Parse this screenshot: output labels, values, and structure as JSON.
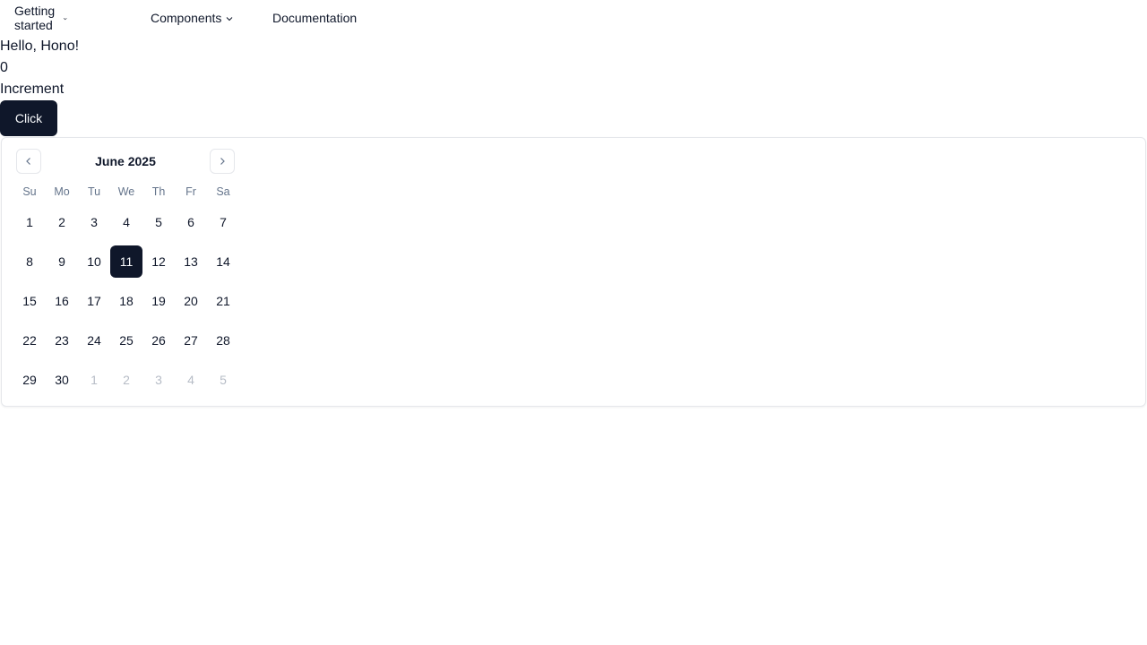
{
  "nav": {
    "getting_started": "Getting started",
    "components": "Components",
    "documentation": "Documentation"
  },
  "content": {
    "greeting": "Hello, Hono!",
    "count": "0",
    "increment_label": "Increment",
    "click_button": "Click"
  },
  "calendar": {
    "month_label": "June 2025",
    "weekdays": [
      "Su",
      "Mo",
      "Tu",
      "We",
      "Th",
      "Fr",
      "Sa"
    ],
    "selected_day": "11",
    "weeks": [
      [
        {
          "d": "1"
        },
        {
          "d": "2"
        },
        {
          "d": "3"
        },
        {
          "d": "4"
        },
        {
          "d": "5"
        },
        {
          "d": "6"
        },
        {
          "d": "7"
        }
      ],
      [
        {
          "d": "8"
        },
        {
          "d": "9"
        },
        {
          "d": "10"
        },
        {
          "d": "11",
          "sel": true
        },
        {
          "d": "12"
        },
        {
          "d": "13"
        },
        {
          "d": "14"
        }
      ],
      [
        {
          "d": "15"
        },
        {
          "d": "16"
        },
        {
          "d": "17"
        },
        {
          "d": "18"
        },
        {
          "d": "19"
        },
        {
          "d": "20"
        },
        {
          "d": "21"
        }
      ],
      [
        {
          "d": "22"
        },
        {
          "d": "23"
        },
        {
          "d": "24"
        },
        {
          "d": "25"
        },
        {
          "d": "26"
        },
        {
          "d": "27"
        },
        {
          "d": "28"
        }
      ],
      [
        {
          "d": "29"
        },
        {
          "d": "30"
        },
        {
          "d": "1",
          "out": true
        },
        {
          "d": "2",
          "out": true
        },
        {
          "d": "3",
          "out": true
        },
        {
          "d": "4",
          "out": true
        },
        {
          "d": "5",
          "out": true
        }
      ]
    ]
  },
  "colors": {
    "primary": "#0f172a",
    "muted": "#64748b",
    "outside_day": "#b6bcc6",
    "border": "#e5e7eb"
  },
  "icons": {
    "dropdown": "chevron-down-icon",
    "prev_month": "chevron-left-icon",
    "next_month": "chevron-right-icon"
  }
}
